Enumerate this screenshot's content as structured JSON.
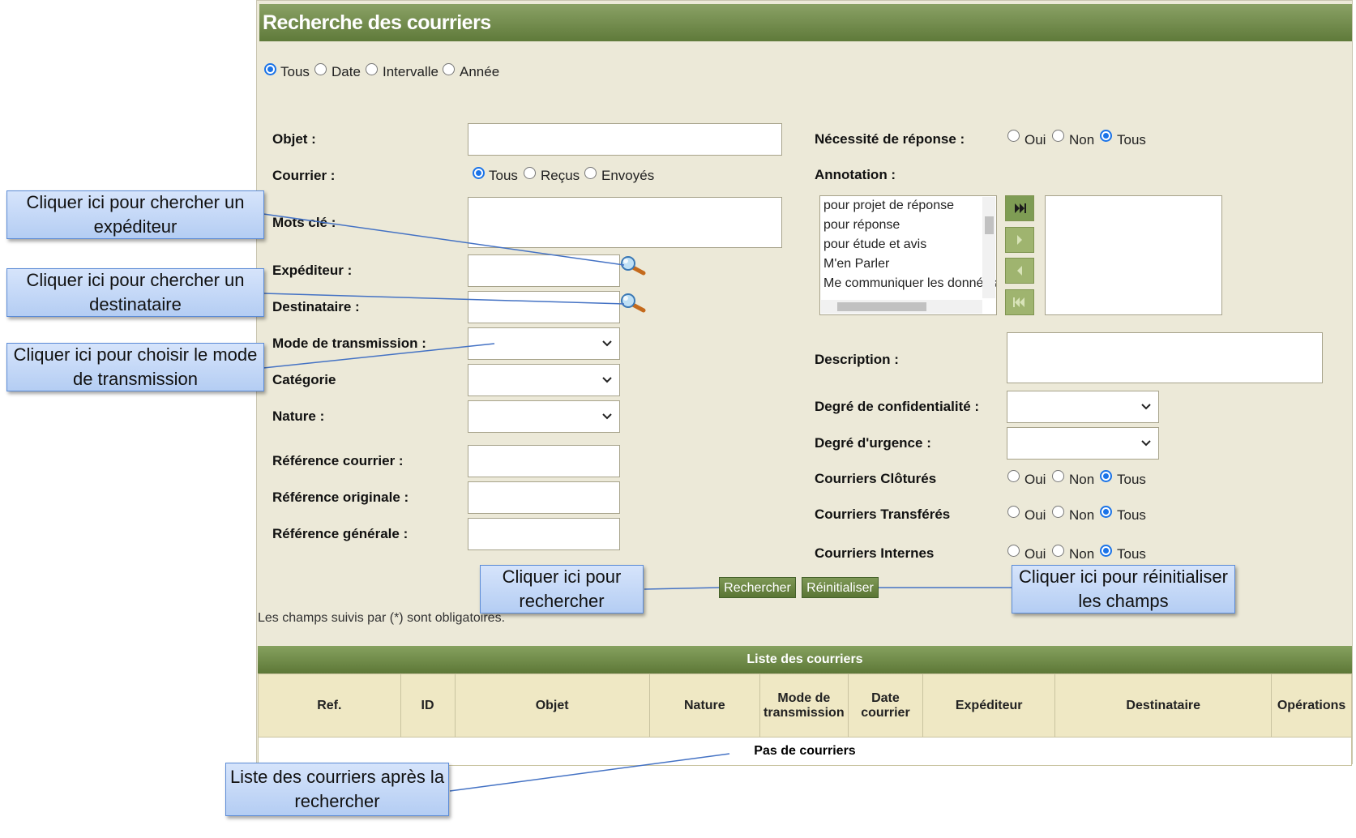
{
  "header": {
    "title": "Recherche des courriers"
  },
  "period_filter": {
    "options": [
      "Tous",
      "Date",
      "Intervalle",
      "Année"
    ],
    "selected": "Tous"
  },
  "form_left": {
    "objet_label": "Objet :",
    "courrier_label": "Courrier :",
    "courrier_options": [
      "Tous",
      "Reçus",
      "Envoyés"
    ],
    "courrier_selected": "Tous",
    "mots_cle_label": "Mots clé :",
    "expediteur_label": "Expéditeur :",
    "destinataire_label": "Destinataire :",
    "mode_label": "Mode de transmission :",
    "categorie_label": "Catégorie",
    "nature_label": "Nature :",
    "ref_courrier_label": "Référence courrier :",
    "ref_originale_label": "Référence originale :",
    "ref_generale_label": "Référence générale :"
  },
  "form_right": {
    "necessite_label": "Nécessité de réponse :",
    "annotation_label": "Annotation :",
    "annotation_options": [
      "pour projet de réponse",
      "pour réponse",
      "pour étude et avis",
      "M'en Parler",
      "Me communiquer les données"
    ],
    "description_label": "Description :",
    "confidentialite_label": "Degré de confidentialité :",
    "urgence_label": "Degré d'urgence :",
    "clotures_label": "Courriers Clôturés",
    "transferes_label": "Courriers Transférés",
    "internes_label": "Courriers Internes",
    "yes_no_all": [
      "Oui",
      "Non",
      "Tous"
    ],
    "yes_no_all_selected": "Tous"
  },
  "actions": {
    "search": "Rechercher",
    "reset": "Réinitialiser"
  },
  "required_note": "Les champs suivis par (*) sont obligatoires.",
  "results": {
    "title": "Liste des courriers",
    "columns": [
      "Ref.",
      "ID",
      "Objet",
      "Nature",
      "Mode de transmission",
      "Date courrier",
      "Expéditeur",
      "Destinataire",
      "Opérations"
    ],
    "empty_text": "Pas de courriers"
  },
  "callouts": {
    "expediteur": "Cliquer ici pour chercher un expéditeur",
    "destinataire": "Cliquer ici pour chercher un destinataire",
    "mode": "Cliquer ici pour choisir le mode de transmission",
    "search": "Cliquer ici pour rechercher",
    "reset": "Cliquer ici pour réinitialiser les champs",
    "list": "Liste des courriers après la rechercher"
  },
  "colors": {
    "header_green": "#6b8544",
    "panel_bg": "#ece9d8",
    "callout_blue": "#c5d9f7"
  }
}
